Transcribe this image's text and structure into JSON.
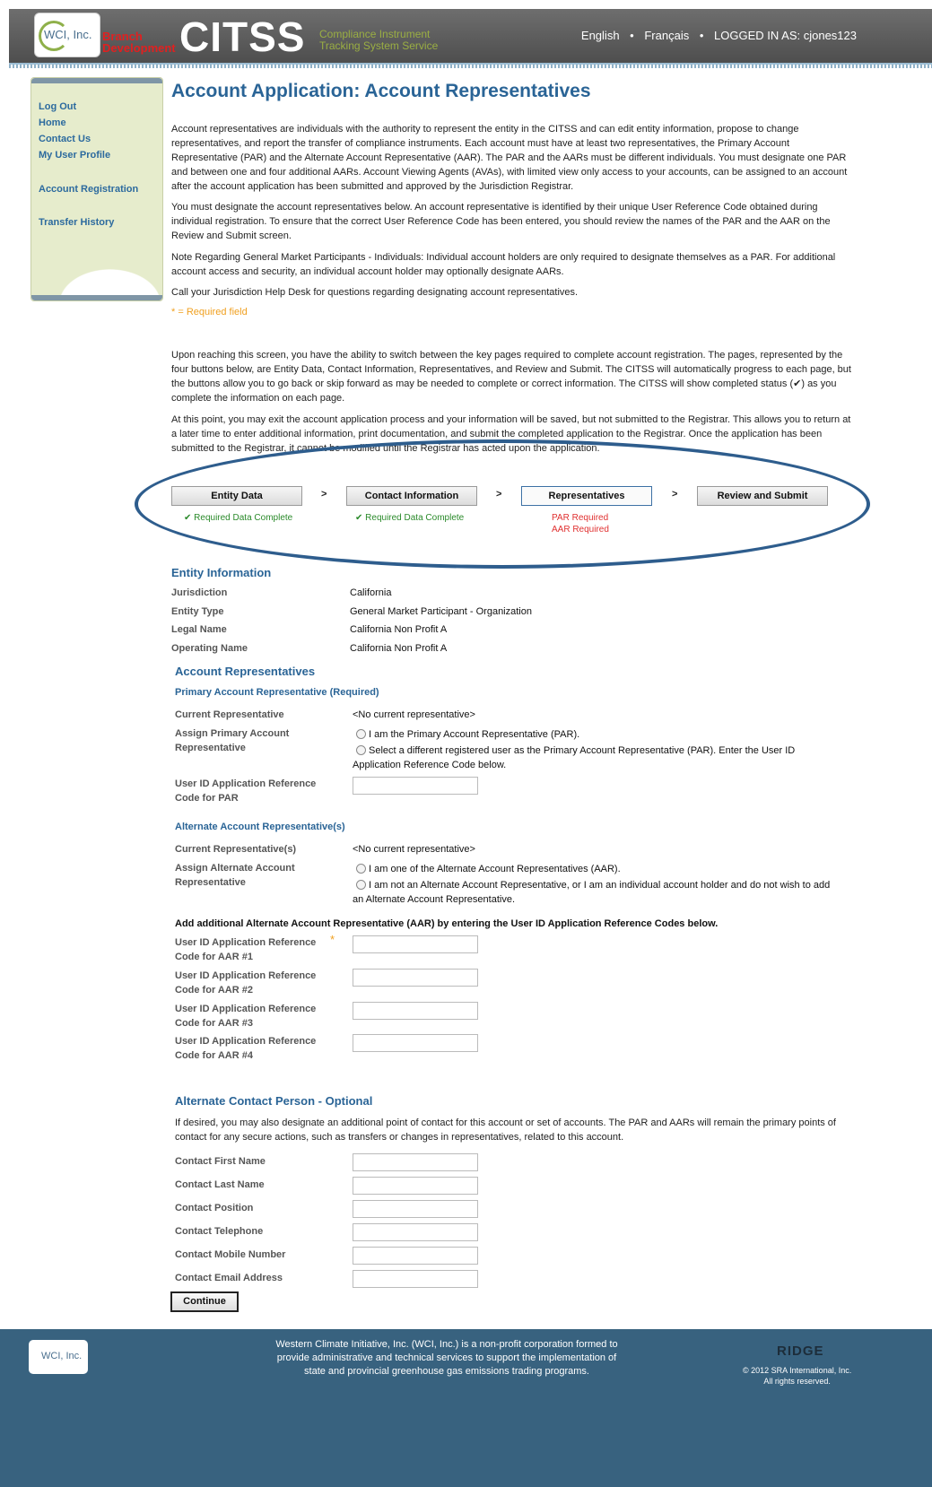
{
  "header": {
    "logo_text": "WCI, Inc.",
    "branch_label": "Branch Development",
    "app_name": "CITSS",
    "app_subtitle_line1": "Compliance Instrument",
    "app_subtitle_line2": "Tracking System Service",
    "lang_english": "English",
    "lang_french": "Français",
    "logged_in": "LOGGED IN AS:  cjones123",
    "separator": "•"
  },
  "sidebar": {
    "items": [
      {
        "label": "Log Out"
      },
      {
        "label": "Home"
      },
      {
        "label": "Contact Us"
      },
      {
        "label": "My User Profile"
      },
      {
        "label": "Account Registration"
      },
      {
        "label": "Transfer History"
      }
    ]
  },
  "page": {
    "title": "Account Application: Account Representatives",
    "intro1": "Account representatives are individuals with the authority to represent the entity in the CITSS and can edit entity information, propose to change representatives, and report the transfer of compliance instruments. Each account must have at least two representatives, the Primary Account Representative (PAR) and the Alternate Account Representative (AAR). The PAR and the AARs must be different individuals. You must designate one PAR and between one and four additional AARs. Account Viewing Agents (AVAs), with limited view only access to your accounts, can be assigned to an account after the account application has been submitted and approved by the Jurisdiction Registrar.",
    "intro2": "You must designate the account representatives below. An account representative is identified by their unique User Reference Code obtained during individual registration. To ensure that the correct User Reference Code has been entered, you should review the names of the PAR and the AAR on the Review and Submit screen.",
    "intro3": "Note Regarding General Market Participants - Individuals: Individual account holders are only required to designate themselves as a PAR. For additional account access and security, an individual account holder may optionally designate AARs.",
    "intro4": "Call your Jurisdiction Help Desk for questions regarding designating account representatives.",
    "required_note": "* = Required field",
    "nav_para1": "Upon reaching this screen, you have the ability to switch between the key pages required to complete account registration. The pages, represented by the four buttons below, are Entity Data, Contact Information, Representatives, and Review and Submit. The CITSS will automatically progress to each page, but the buttons allow you to go back or skip forward as may be needed to complete or correct information. The CITSS will show completed status (✔) as you complete the information on each page.",
    "nav_para2": "At this point, you may exit the account application process and your information will be saved, but not submitted to the Registrar. This allows you to return at a later time to enter additional information, print documentation, and submit the completed application to the Registrar. Once the application has been submitted to the Registrar, it cannot be modified until the Registrar has acted upon the application."
  },
  "steps": [
    {
      "label": "Entity Data",
      "status": "✔ Required Data Complete"
    },
    {
      "label": "Contact Information",
      "status": "✔ Required Data Complete"
    },
    {
      "label": "Representatives",
      "status1": "PAR Required",
      "status2": "AAR Required"
    },
    {
      "label": "Review and Submit"
    }
  ],
  "step_arrow": ">",
  "entity": {
    "heading": "Entity Information",
    "rows": [
      {
        "label": "Jurisdiction",
        "value": "California"
      },
      {
        "label": "Entity Type",
        "value": "General Market Participant - Organization"
      },
      {
        "label": "Legal Name",
        "value": "California Non Profit A"
      },
      {
        "label": "Operating Name",
        "value": "California Non Profit A"
      }
    ]
  },
  "reps": {
    "heading": "Account Representatives",
    "par_heading": "Primary Account Representative (Required)",
    "par_current_label": "Current Representative",
    "par_current_value": "<No current representative>",
    "par_assign_label": "Assign Primary Account Representative",
    "par_option1": "I am the Primary Account Representative (PAR).",
    "par_option2": "Select a different registered user as the Primary Account Representative (PAR). Enter the User ID Application Reference Code below.",
    "par_code_label": "User ID Application Reference Code for PAR",
    "aar_heading": "Alternate Account Representative(s)",
    "aar_current_label": "Current Representative(s)",
    "aar_current_value": "<No current representative>",
    "aar_assign_label": "Assign Alternate Account Representative",
    "aar_option1": "I am one of the Alternate Account Representatives (AAR).",
    "aar_option2": "I am not an Alternate Account Representative, or I am an individual account holder and do not wish to add an Alternate Account Representative.",
    "aar_add_line": "Add additional Alternate Account Representative (AAR) by entering the User ID Application Reference Codes below.",
    "aar_codes": [
      {
        "label": "User ID Application Reference Code for AAR #1"
      },
      {
        "label": "User ID Application Reference Code for AAR #2"
      },
      {
        "label": "User ID Application Reference Code for AAR #3"
      },
      {
        "label": "User ID Application Reference Code for AAR #4"
      }
    ],
    "star": "*"
  },
  "alt_contact": {
    "heading": "Alternate Contact Person - Optional",
    "intro": "If desired, you may also designate an additional point of contact for this account or set of accounts. The PAR and AARs will remain the primary points of contact for any secure actions, such as transfers or changes in representatives, related to this account.",
    "fields": [
      {
        "label": "Contact First Name"
      },
      {
        "label": "Contact Last Name"
      },
      {
        "label": "Contact Position"
      },
      {
        "label": "Contact Telephone"
      },
      {
        "label": "Contact Mobile Number"
      },
      {
        "label": "Contact Email Address"
      }
    ]
  },
  "continue_label": "Continue",
  "footer": {
    "logo_text": "WCI, Inc.",
    "text": "Western Climate Initiative, Inc. (WCI, Inc.) is a non-profit corporation formed to provide administrative and technical services to support the implementation of state and provincial greenhouse gas emissions trading programs.",
    "ridge": "RIDGE",
    "copyright_line1": "© 2012 SRA International, Inc.",
    "copyright_line2": "All rights reserved."
  }
}
